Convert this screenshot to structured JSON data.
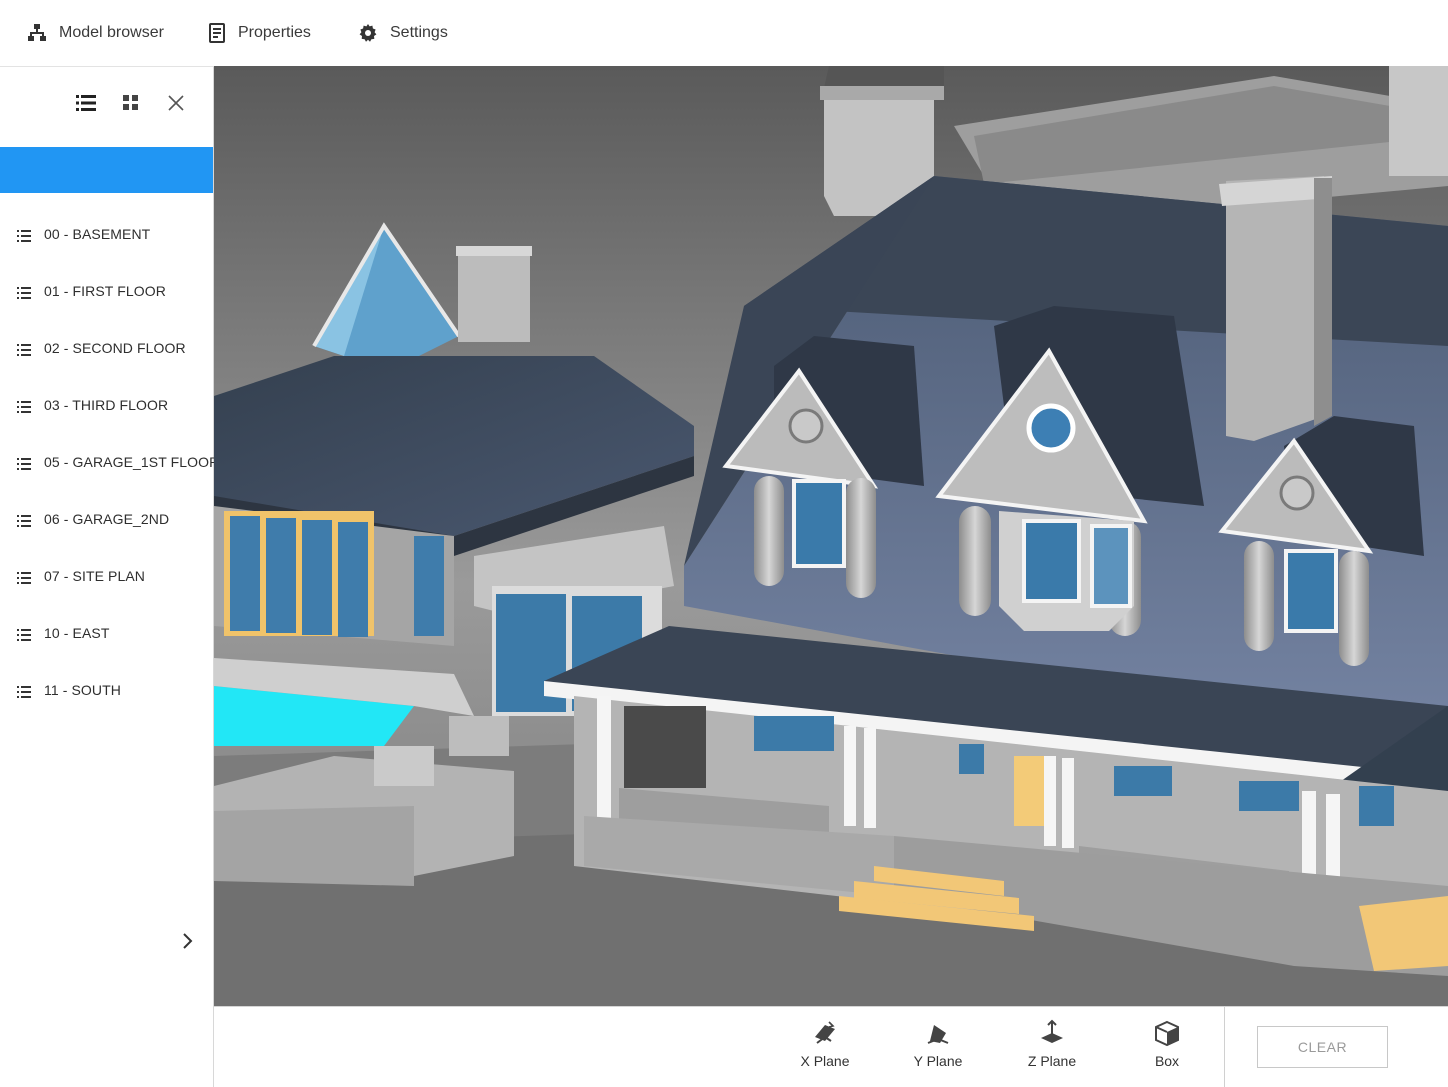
{
  "topbar": {
    "items": [
      {
        "label": "Model browser",
        "icon": "hierarchy-icon"
      },
      {
        "label": "Properties",
        "icon": "document-icon"
      },
      {
        "label": "Settings",
        "icon": "gear-icon"
      }
    ]
  },
  "sidebar": {
    "tools": [
      {
        "icon": "list-view-icon"
      },
      {
        "icon": "grid-view-icon"
      },
      {
        "icon": "close-icon"
      }
    ],
    "selected_label": "",
    "items": [
      {
        "label": "00 - BASEMENT"
      },
      {
        "label": "01 - FIRST FLOOR"
      },
      {
        "label": "02 - SECOND FLOOR"
      },
      {
        "label": "03 - THIRD FLOOR"
      },
      {
        "label": "05 - GARAGE_1ST FLOOR"
      },
      {
        "label": "06 - GARAGE_2ND"
      },
      {
        "label": "07 - SITE PLAN"
      },
      {
        "label": "10 - EAST"
      },
      {
        "label": "11 - SOUTH"
      }
    ],
    "expand_icon": "chevron-right-icon"
  },
  "viewport": {
    "content": "3d-house-model",
    "colors": {
      "roof": "#3c4a5e",
      "wall": "#b9b9b9",
      "glass": "#3a78a6",
      "pool": "#1ee5f5",
      "wood": "#f2c777"
    }
  },
  "bottombar": {
    "tools": [
      {
        "label": "X Plane",
        "icon": "x-plane-icon"
      },
      {
        "label": "Y Plane",
        "icon": "y-plane-icon"
      },
      {
        "label": "Z Plane",
        "icon": "z-plane-icon"
      },
      {
        "label": "Box",
        "icon": "box-icon"
      }
    ],
    "clear_label": "CLEAR"
  },
  "colors": {
    "accent": "#2196f3",
    "text": "#3a3a3a",
    "border": "#d5d5d5"
  }
}
